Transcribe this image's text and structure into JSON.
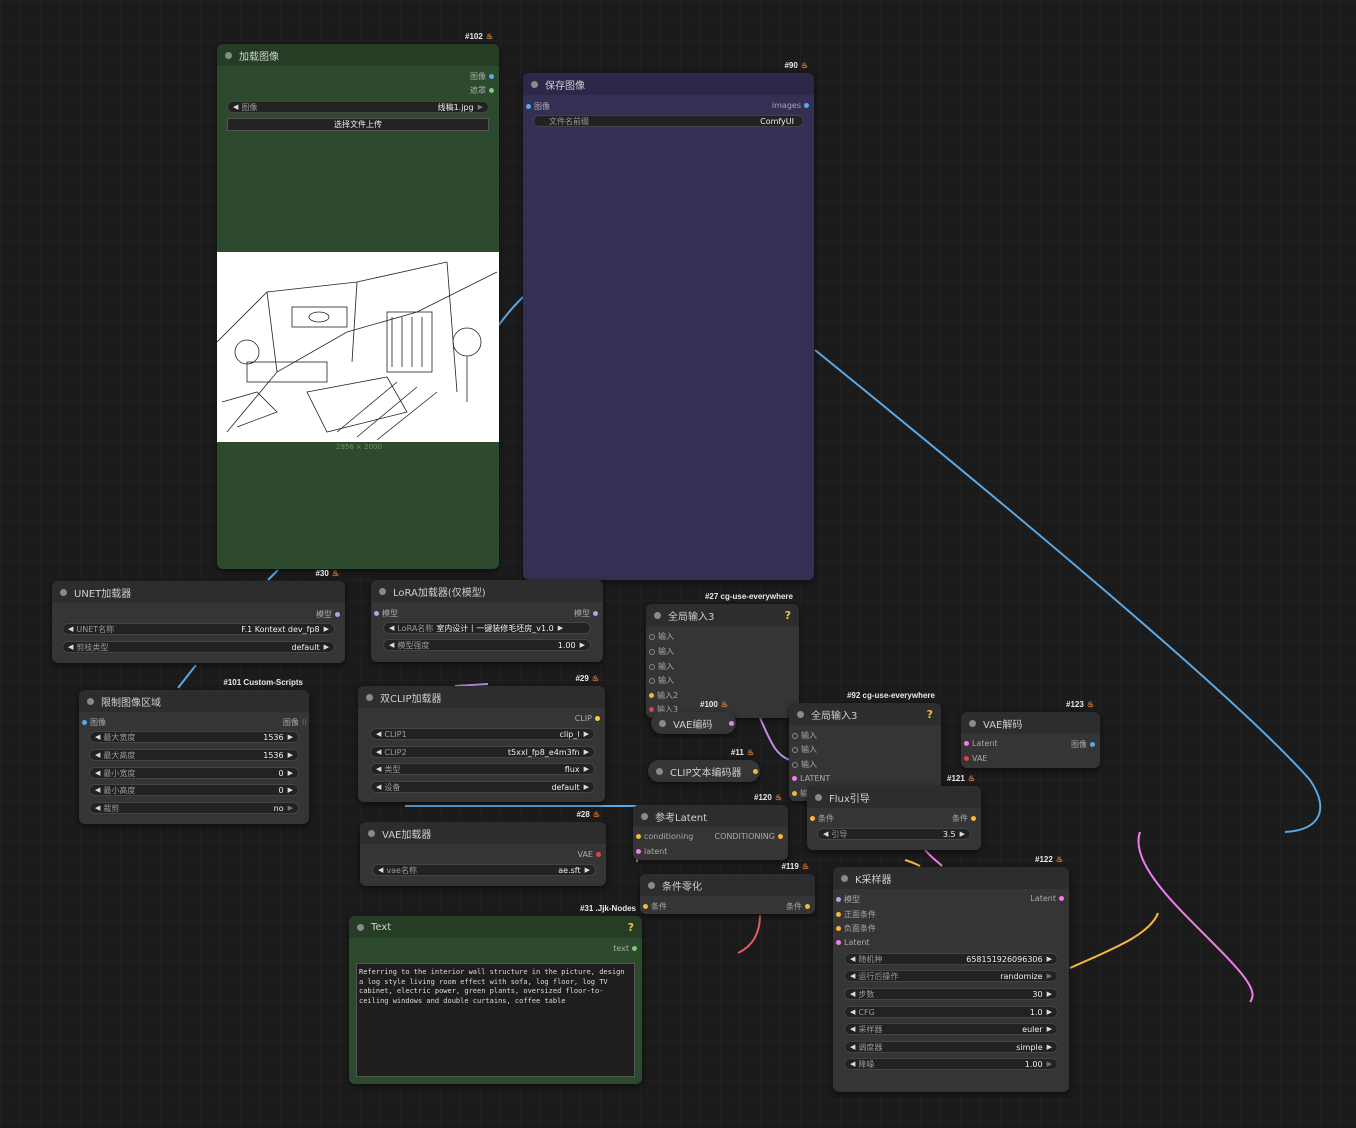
{
  "colors": {
    "canvas": "#1b1b1b",
    "node": "#353535",
    "load_image_node": "#2e4a2e",
    "save_image_node": "#332f55",
    "wire_image": "#5aa9e6",
    "wire_model": "#f07cf0",
    "wire_clip": "#f5b540",
    "wire_cond": "#e05a6a"
  },
  "nodes": {
    "load_image": {
      "id": "#102",
      "title": "加载图像",
      "out1": "图像",
      "out2": "遮罩",
      "w_image_label": "图像",
      "w_image_value": "线稿1.jpg",
      "upload_label": "选择文件上传",
      "size_caption": "2956 × 2000"
    },
    "save_image": {
      "id": "#90",
      "title": "保存图像",
      "in1": "图像",
      "out1": "images",
      "w_prefix_label": "文件名前缀",
      "w_prefix_value": "ComfyUI"
    },
    "unet": {
      "id": "#30",
      "title": "UNET加载器",
      "out1": "模型",
      "w1_label": "UNET名称",
      "w1_value": "F.1 Kontext dev_fp8",
      "w2_label": "剪枝类型",
      "w2_value": "default"
    },
    "lora": {
      "title": "LoRA加载器(仅模型)",
      "in1": "模型",
      "out1": "模型",
      "w1_label": "LoRA名称",
      "w1_value": "室内设计丨一键装修毛坯房_v1.0",
      "w2_label": "模型强度",
      "w2_value": "1.00"
    },
    "limit": {
      "id": "#101 Custom-Scripts",
      "title": "限制图像区域",
      "in1": "图像",
      "out1": "图像",
      "w1_label": "最大宽度",
      "w1_value": "1536",
      "w2_label": "最大高度",
      "w2_value": "1536",
      "w3_label": "最小宽度",
      "w3_value": "0",
      "w4_label": "最小高度",
      "w4_value": "0",
      "w5_label": "裁剪",
      "w5_value": "no"
    },
    "dualclip": {
      "id": "#29",
      "title": "双CLIP加载器",
      "out1": "CLIP",
      "w1_label": "CLIP1",
      "w1_value": "clip_l",
      "w2_label": "CLIP2",
      "w2_value": "t5xxl_fp8_e4m3fn",
      "w3_label": "类型",
      "w3_value": "flux",
      "w4_label": "设备",
      "w4_value": "default"
    },
    "vaeloader": {
      "id": "#28",
      "title": "VAE加载器",
      "out1": "VAE",
      "w1_label": "vae名称",
      "w1_value": "ae.sft"
    },
    "text": {
      "id": "#31 .Jjk-Nodes",
      "title": "Text",
      "out1": "text",
      "content": "Referring to the interior wall structure in the picture, design a log style living room effect with sofa, log floor, log TV cabinet, electric power, green plants, oversized floor-to-ceiling windows and double curtains, coffee table"
    },
    "anything27": {
      "id": "#27 cg-use-everywhere",
      "title": "全局输入3",
      "in1": "输入",
      "in2": "输入",
      "in3": "输入",
      "in4": "输入",
      "in5": "输入2",
      "in6": "输入3"
    },
    "vaeencode": {
      "id": "#100",
      "title": "VAE编码"
    },
    "clipencode": {
      "id": "#11",
      "title": "CLIP文本编码器"
    },
    "anything92": {
      "id": "#92 cg-use-everywhere",
      "title": "全局输入3",
      "in1": "输入",
      "in2": "输入",
      "in3": "输入",
      "in4": "LATENT",
      "in5": "输"
    },
    "vaedecode": {
      "id": "#123",
      "title": "VAE解码",
      "in1": "Latent",
      "in2": "VAE",
      "out1": "图像"
    },
    "reflatent": {
      "id": "#120",
      "title": "参考Latent",
      "in1": "conditioning",
      "out1": "CONDITIONING",
      "in2": "latent"
    },
    "fluxguide": {
      "id": "#121",
      "title": "Flux引导",
      "in1": "条件",
      "out1": "条件",
      "w1_label": "引导",
      "w1_value": "3.5"
    },
    "condzero": {
      "id": "#119",
      "title": "条件零化",
      "in1": "条件",
      "out1": "条件"
    },
    "ksampler": {
      "id": "#122",
      "title": "K采样器",
      "in1": "模型",
      "in2": "正面条件",
      "in3": "负面条件",
      "in4": "Latent",
      "out1": "Latent",
      "w1_label": "随机种",
      "w1_value": "658151926096306",
      "w2_label": "运行后操作",
      "w2_value": "randomize",
      "w3_label": "步数",
      "w3_value": "30",
      "w4_label": "CFG",
      "w4_value": "1.0",
      "w5_label": "采样器",
      "w5_value": "euler",
      "w6_label": "调度器",
      "w6_value": "simple",
      "w7_label": "降噪",
      "w7_value": "1.00"
    }
  }
}
